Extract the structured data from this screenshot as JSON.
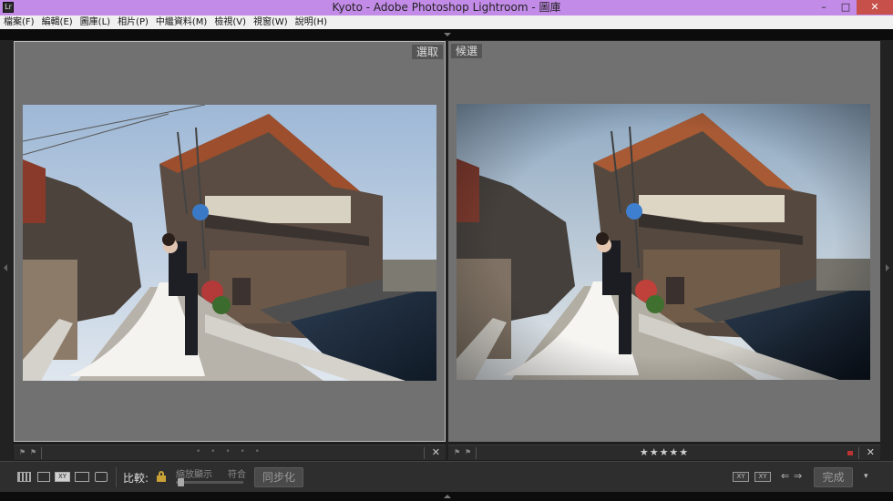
{
  "window": {
    "title": "Kyoto - Adobe Photoshop Lightroom - 圖庫",
    "app_icon_text": "Lr",
    "buttons": {
      "minimize": "–",
      "maximize": "□",
      "close": "✕"
    }
  },
  "menu": [
    "檔案(F)",
    "編輯(E)",
    "圖庫(L)",
    "相片(P)",
    "中繼資料(M)",
    "檢視(V)",
    "視窗(W)",
    "說明(H)"
  ],
  "compare": {
    "select_label": "選取",
    "candidate_label": "候選",
    "candidate_rating": "★★★★★",
    "select_dots": "• • • • •",
    "close_glyph": "✕"
  },
  "toolbar": {
    "compare_label": "比較:",
    "zoom_label": "縮放顯示",
    "fit_label": "符合",
    "zoom_level": 0.03,
    "sync_button": "同步化",
    "done_button": "完成",
    "xy_label": "XY",
    "swap_a_label": "XY",
    "swap_b_label": "XY",
    "prev_arrow": "⇐",
    "next_arrow": "⇒",
    "menu_arrow": "▾"
  },
  "colors": {
    "title_bar": "#c38be8",
    "close_button": "#c7504a",
    "pane_background": "#717171",
    "lock": "#c9a236"
  },
  "icons": {
    "grid_view": "grid-view-icon",
    "loupe_view": "loupe-view-icon",
    "compare_view": "compare-view-icon",
    "survey_view": "survey-view-icon",
    "people_view": "people-view-icon",
    "lock": "lock-icon"
  }
}
